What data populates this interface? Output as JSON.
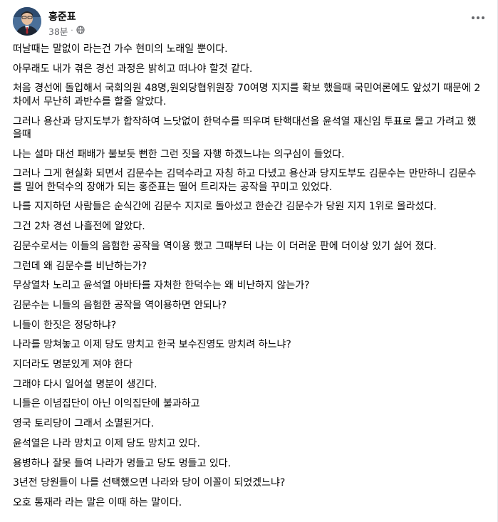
{
  "post": {
    "author": "홍준표",
    "time": "38분",
    "privacy_icon": "globe-icon",
    "more_icon": "more-options-icon",
    "paragraphs": [
      [
        "떠날때는 말없이 라는건 가수 현미의 노래일 뿐이다."
      ],
      [
        "아무래도 내가 겪은 경선 과정은 밝히고 떠나야 할것 같다."
      ],
      [
        "처음 경선에 돌입해서 국회의원 48명,원외당협위원장 70여명 지지를 확보 했을때 국민여론에도 앞섰기 때문에 2",
        "차에서 무난히 과반수를 할줄 알았다."
      ],
      [
        "그러나 용산과 당지도부가 합작하여 느닷없이 한덕수를 띄우며 탄핵대선을 윤석열 재신임 투표로 몰고 가려고 했",
        "을때"
      ],
      [
        "나는 설마 대선 패배가 불보듯 뻔한 그런 짓을 자행 하겠느냐는 의구심이 들었다."
      ],
      [
        "그러나 그게 현실화 되면서 김문수는 김덕수라고 자칭 하고 다녔고 용산과 당지도부도 김문수는 만만하니 김문수",
        "를 밀어 한덕수의 장애가 되는 홍준표는 떨어 트리자는 공작을  꾸미고 있었다."
      ],
      [
        "나를 지지하던 사람들은 순식간에 김문수 지지로 돌아섰고 한순간 김문수가 당원 지지 1위로 올라섰다."
      ],
      [
        "그건 2차 경선 나흘전에 알았다."
      ],
      [
        "김문수로서는 이들의 음험한 공작을 역이용 했고 그때부터 나는 이 더러운 판에 더이상 있기 싫어 졌다."
      ],
      [
        "그런데 왜 김문수를 비난하는가?"
      ],
      [
        "무상열차 노리고 윤석열 아바타를 자처한 한덕수는 왜 비난하지 않는가?"
      ],
      [
        "김문수는 니들의 음험한 공작을 역이용하면 안되나?"
      ],
      [
        "니들이 한짓은 정당하냐?"
      ],
      [
        "나라를 망쳐놓고 이제 당도 망치고 한국 보수진영도 망치려 하느냐?"
      ],
      [
        "지더라도 명분있게 져야 한다"
      ],
      [
        "그래야 다시 일어설 명분이 생긴다."
      ],
      [
        "니들은 이념집단이 아닌 이익집단에 불과하고"
      ],
      [
        "영국  토리당이 그래서 소멸된거다."
      ],
      [
        "윤석열은 나라 망치고 이제 당도 망치고 있다."
      ],
      [
        "용병하나 잘못 들여 나라가 멍들고 당도 멍들고 있다."
      ],
      [
        "3년전 당원들이 나를 선택했으면 나라와 당이 이꼴이 되었겠느냐?"
      ],
      [
        "오호 통재라 라는 말은 이때 하는 말이다."
      ]
    ]
  },
  "colors": {
    "text": "#050505",
    "secondary": "#65676b"
  }
}
